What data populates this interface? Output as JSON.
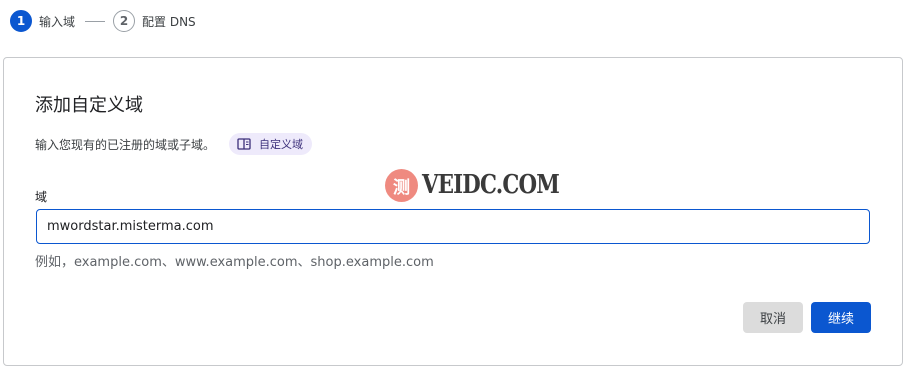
{
  "stepper": {
    "steps": [
      {
        "number": "1",
        "label": "输入域",
        "state": "active"
      },
      {
        "number": "2",
        "label": "配置 DNS",
        "state": "inactive"
      }
    ]
  },
  "card": {
    "title": "添加自定义域",
    "description": "输入您现有的已注册的域或子域。",
    "doc_link": {
      "label": "自定义域",
      "icon": "book-icon"
    },
    "field_label": "域",
    "input_value": "mwordstar.misterma.com",
    "hint": "例如，example.com、www.example.com、shop.example.com",
    "cancel_label": "取消",
    "continue_label": "继续"
  },
  "watermark": {
    "seal_char": "测",
    "text": "VEIDC.COM"
  },
  "colors": {
    "primary": "#0b57d0",
    "link_chip_bg": "#eeeafb",
    "cancel_bg": "#dcdcdc",
    "border": "#c7c9cc",
    "watermark_seal": "#ef8a80"
  }
}
